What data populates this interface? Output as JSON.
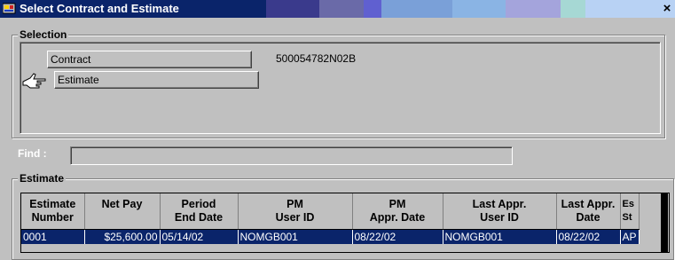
{
  "window": {
    "title": "Select Contract and Estimate",
    "close": "×",
    "colors": {
      "title_dark": "#0a246a",
      "title_gradient": [
        "#5a5a9c",
        "#6666cc",
        "#7aa6e0",
        "#8bb8e8",
        "#9fc4f0",
        "#a8a8e0",
        "#a6dcd8",
        "#b8d4f8"
      ]
    }
  },
  "selection": {
    "legend": "Selection",
    "contract_button": "Contract",
    "contract_value": "500054782N02B",
    "estimate_button": "Estimate",
    "pointer_icon": "hand-pointer-icon"
  },
  "find": {
    "label": "Find :",
    "value": ""
  },
  "estimate": {
    "legend": "Estimate",
    "columns": [
      "Estimate\nNumber",
      "Net Pay",
      "Period\nEnd Date",
      "PM\nUser ID",
      "PM\nAppr. Date",
      "Last Appr.\nUser ID",
      "Last Appr.\nDate",
      "Es\nSt"
    ],
    "rows": [
      [
        "0001",
        "$25,600.00",
        "05/14/02",
        "NOMGB001",
        "08/22/02",
        "NOMGB001",
        "08/22/02",
        "AP"
      ]
    ]
  }
}
